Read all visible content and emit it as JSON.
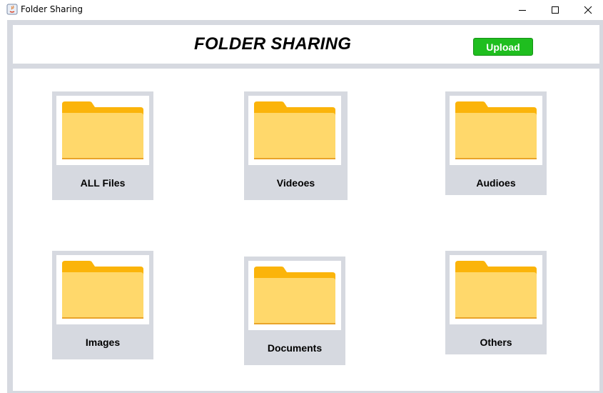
{
  "window": {
    "title": "Folder Sharing",
    "controls": [
      "minimize",
      "maximize",
      "close"
    ]
  },
  "header": {
    "title": "FOLDER SHARING",
    "upload_label": "Upload"
  },
  "folders": [
    {
      "label": "ALL Files",
      "icon": "folder-icon"
    },
    {
      "label": "Videoes",
      "icon": "folder-icon"
    },
    {
      "label": "Audioes",
      "icon": "folder-icon"
    },
    {
      "label": "Images",
      "icon": "folder-icon"
    },
    {
      "label": "Documents",
      "icon": "folder-icon"
    },
    {
      "label": "Others",
      "icon": "folder-icon"
    }
  ],
  "colors": {
    "frame": "#d6d9e0",
    "upload_button": "#1fbe1f",
    "folder_front": "#ffd86b",
    "folder_tab": "#fbb40a"
  }
}
